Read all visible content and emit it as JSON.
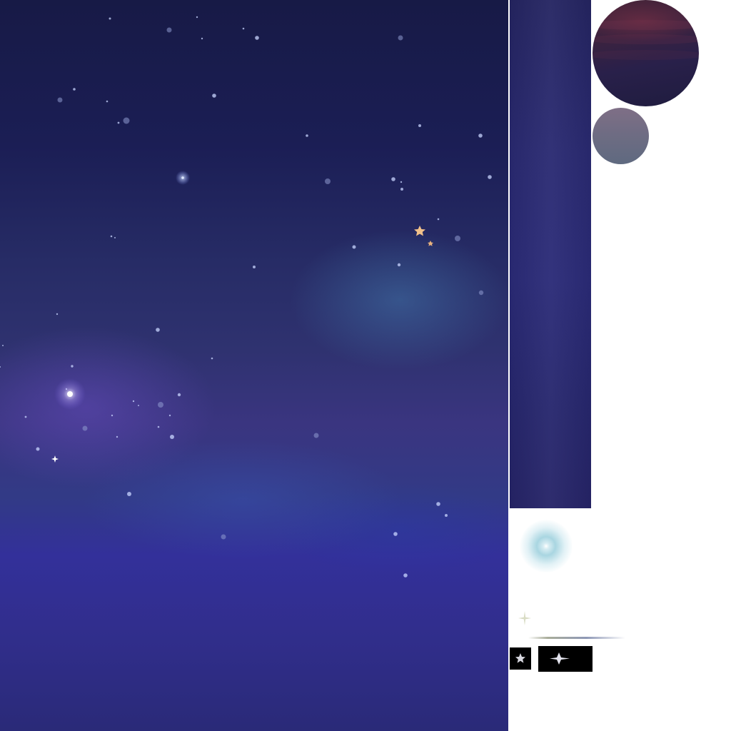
{
  "atlas": {
    "sprites": [
      {
        "name": "starfield-background",
        "kind": "background"
      },
      {
        "name": "gradient-strip",
        "kind": "gradient"
      },
      {
        "name": "planet-large",
        "kind": "planet"
      },
      {
        "name": "planet-small",
        "kind": "planet"
      },
      {
        "name": "glow-orb",
        "kind": "particle"
      },
      {
        "name": "sparkle-small",
        "kind": "particle"
      },
      {
        "name": "streak-line",
        "kind": "particle"
      },
      {
        "name": "star-tile",
        "kind": "particle"
      },
      {
        "name": "sparkle-tile",
        "kind": "particle"
      }
    ]
  },
  "colors": {
    "sky_top": "#171a46",
    "sky_bottom": "#2a2a78",
    "nebula_blue": "#4682b4",
    "nebula_violet": "#6e50c8",
    "strip": "#2a2a72",
    "planet_large": "#29204a",
    "planet_large_highlight": "#4a2438",
    "planet_small": "#6f6c83",
    "glow": "#8cc8d7",
    "gold_star": "#f0c08a",
    "white": "#ffffff"
  },
  "icons": {
    "gold_star": "star-icon",
    "sparkle": "sparkle-icon",
    "star_tile": "star-icon",
    "sparkle_tile": "sparkle-icon"
  }
}
